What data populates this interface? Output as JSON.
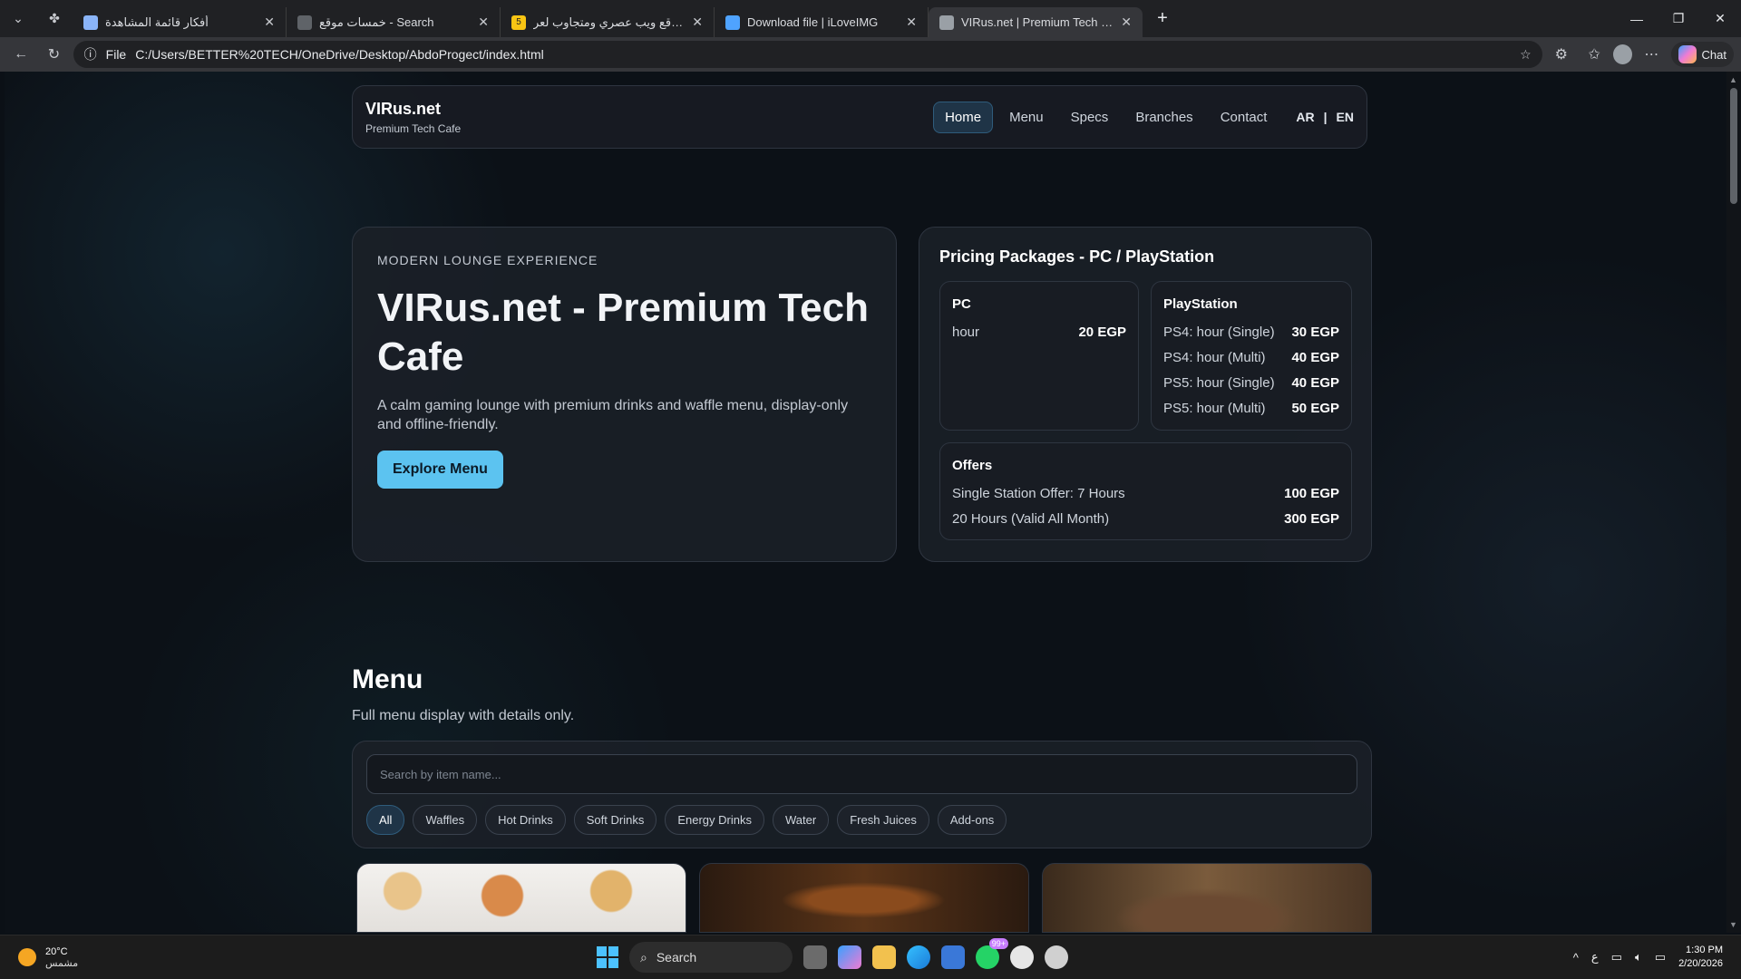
{
  "browser": {
    "tabs": [
      {
        "title": "أفكار قائمة المشاهدة",
        "fav_color": "#8ab4f8",
        "active": false
      },
      {
        "title": "خمسات موقع - Search",
        "fav_color": "#5f6368",
        "active": false
      },
      {
        "title": "إنشاء موقع ويب عصري ومتجاوب لعر",
        "fav_color": "#f9c513",
        "fav_text": "5",
        "active": false
      },
      {
        "title": "Download file | iLoveIMG",
        "fav_color": "#4fa3ff",
        "active": false
      },
      {
        "title": "VIRus.net | Premium Tech Cafe",
        "fav_color": "#9aa0a6",
        "active": true
      }
    ],
    "address": {
      "scheme_label": "File",
      "url": "C:/Users/BETTER%20TECH/OneDrive/Desktop/AbdoProgect/index.html"
    },
    "chat_label": "Chat"
  },
  "site": {
    "brand": {
      "title": "VIRus.net",
      "subtitle": "Premium Tech Cafe"
    },
    "nav": [
      {
        "label": "Home",
        "active": true
      },
      {
        "label": "Menu",
        "active": false
      },
      {
        "label": "Specs",
        "active": false
      },
      {
        "label": "Branches",
        "active": false
      },
      {
        "label": "Contact",
        "active": false
      }
    ],
    "lang": {
      "ar": "AR",
      "sep": "|",
      "en": "EN"
    },
    "hero": {
      "eyebrow": "MODERN LOUNGE EXPERIENCE",
      "title": "VIRus.net - Premium Tech Cafe",
      "description": "A calm gaming lounge with premium drinks and waffle menu, display-only and offline-friendly.",
      "cta": "Explore Menu"
    },
    "pricing": {
      "title": "Pricing Packages - PC / PlayStation",
      "pc": {
        "title": "PC",
        "rows": [
          {
            "label": "hour",
            "price": "20 EGP"
          }
        ]
      },
      "playstation": {
        "title": "PlayStation",
        "rows": [
          {
            "label": "PS4: hour (Single)",
            "price": "30 EGP"
          },
          {
            "label": "PS4: hour (Multi)",
            "price": "40 EGP"
          },
          {
            "label": "PS5: hour (Single)",
            "price": "40 EGP"
          },
          {
            "label": "PS5: hour (Multi)",
            "price": "50 EGP"
          }
        ]
      },
      "offers": {
        "title": "Offers",
        "rows": [
          {
            "label": "Single Station Offer: 7 Hours",
            "price": "100 EGP"
          },
          {
            "label": "20 Hours (Valid All Month)",
            "price": "300 EGP"
          }
        ]
      }
    },
    "menu": {
      "title": "Menu",
      "subtitle": "Full menu display with details only.",
      "search_placeholder": "Search by item name...",
      "filters": [
        {
          "label": "All",
          "active": true
        },
        {
          "label": "Waffles",
          "active": false
        },
        {
          "label": "Hot Drinks",
          "active": false
        },
        {
          "label": "Soft Drinks",
          "active": false
        },
        {
          "label": "Energy Drinks",
          "active": false
        },
        {
          "label": "Water",
          "active": false
        },
        {
          "label": "Fresh Juices",
          "active": false
        },
        {
          "label": "Add-ons",
          "active": false
        }
      ]
    }
  },
  "taskbar": {
    "weather": {
      "temp": "20°C",
      "desc": "مشمس"
    },
    "search_label": "Search",
    "badge": "99+",
    "lang_indicator": "ع",
    "time": "1:30 PM",
    "date": "2/20/2026"
  },
  "colors": {
    "accent": "#5cc3f0",
    "active_nav_bg": "#1f3447"
  }
}
